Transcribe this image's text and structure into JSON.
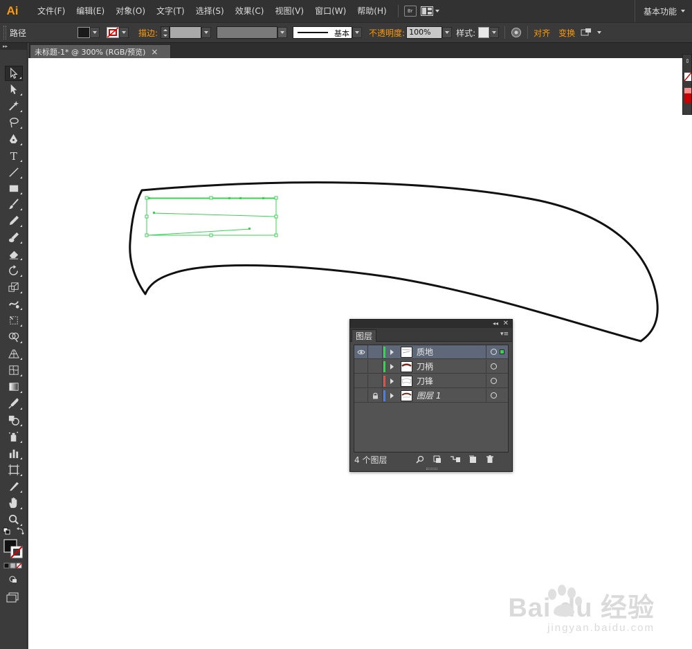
{
  "app": {
    "logo": "Ai",
    "workspace": "基本功能"
  },
  "menu": [
    "文件(F)",
    "编辑(E)",
    "对象(O)",
    "文字(T)",
    "选择(S)",
    "效果(C)",
    "视图(V)",
    "窗口(W)",
    "帮助(H)"
  ],
  "menubar": {
    "bridge_icon": "Br"
  },
  "controlbar": {
    "selection_type": "路径",
    "stroke_label": "描边:",
    "stroke_style": "基本",
    "opacity_label": "不透明度:",
    "opacity_value": "100%",
    "style_label": "样式:",
    "align_label": "对齐",
    "transform_label": "变换"
  },
  "document": {
    "tab_title": "未标题-1* @ 300% (RGB/预览)",
    "close": "×"
  },
  "layers_panel": {
    "tab": "图层",
    "count_label": "4 个图层",
    "layers": [
      {
        "name": "质地",
        "color": "#39d353",
        "visible": true,
        "locked": false,
        "selected": true
      },
      {
        "name": "刀柄",
        "color": "#39d353",
        "visible": false,
        "locked": false,
        "selected": false
      },
      {
        "name": "刀锋",
        "color": "#d9534f",
        "visible": false,
        "locked": false,
        "selected": false
      },
      {
        "name": "图层 1",
        "color": "#4f7fd9",
        "visible": false,
        "locked": true,
        "selected": false
      }
    ]
  },
  "watermark": {
    "brand": "Bai du 经验",
    "url": "jingyan.baidu.com"
  },
  "colors": {
    "accent": "#ff9a00",
    "selection_green": "#39d353"
  }
}
